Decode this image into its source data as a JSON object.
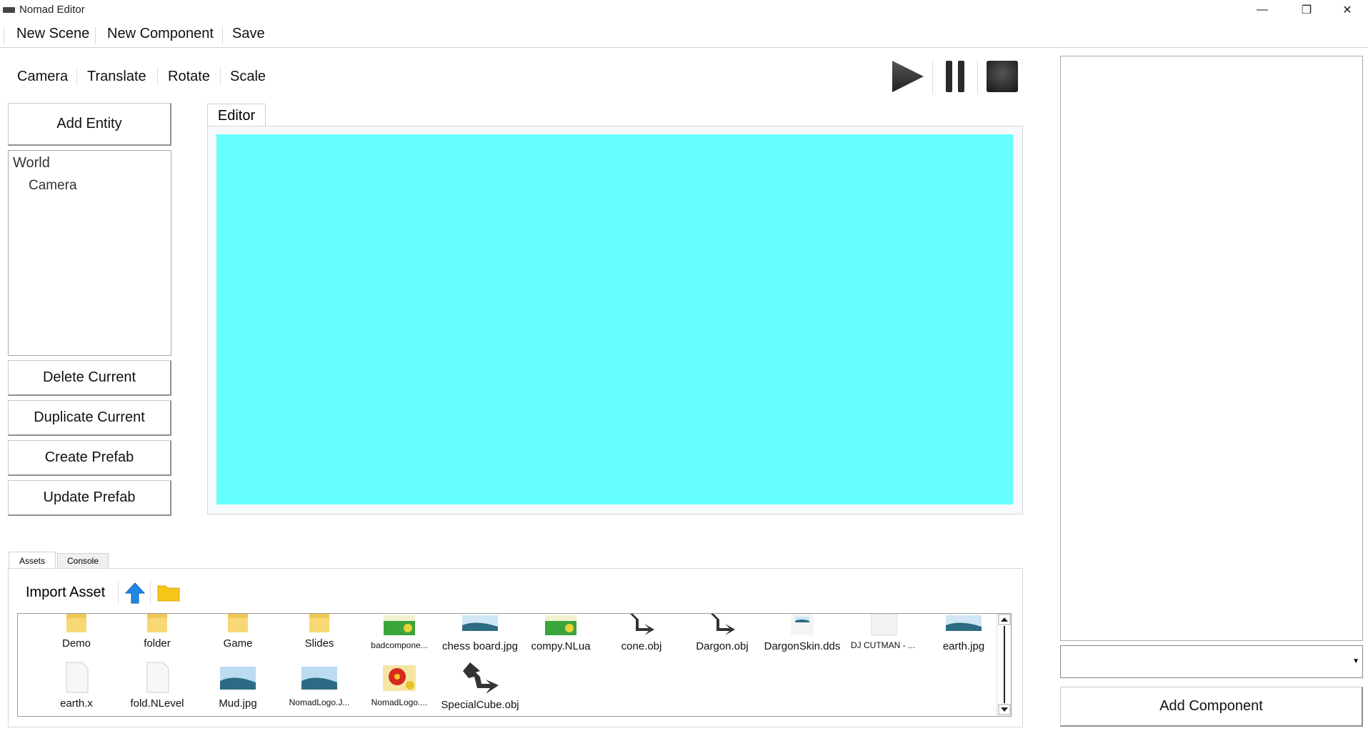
{
  "window": {
    "title": "Nomad Editor"
  },
  "menu": {
    "new_scene": "New Scene",
    "new_component": "New Component",
    "save": "Save"
  },
  "toolbar": {
    "camera": "Camera",
    "translate": "Translate",
    "rotate": "Rotate",
    "scale": "Scale"
  },
  "left_panel": {
    "add_entity": "Add Entity",
    "hierarchy": {
      "root": "World",
      "children": [
        "Camera"
      ]
    },
    "delete_current": "Delete Current",
    "duplicate_current": "Duplicate Current",
    "create_prefab": "Create Prefab",
    "update_prefab": "Update Prefab"
  },
  "editor": {
    "tab_label": "Editor",
    "viewport_color": "#66ffff"
  },
  "bottom": {
    "tabs": [
      "Assets",
      "Console"
    ],
    "import_asset": "Import Asset",
    "assets": [
      {
        "name": "Demo",
        "icon": "folder-icon"
      },
      {
        "name": "folder",
        "icon": "folder-icon"
      },
      {
        "name": "Game",
        "icon": "folder-icon"
      },
      {
        "name": "Slides",
        "icon": "folder-icon"
      },
      {
        "name": "badcompone...",
        "icon": "lua-script-icon"
      },
      {
        "name": "chess board.jpg",
        "icon": "image-icon"
      },
      {
        "name": "compy.NLua",
        "icon": "lua-script-icon"
      },
      {
        "name": "cone.obj",
        "icon": "mesh-icon"
      },
      {
        "name": "Dargon.obj",
        "icon": "mesh-icon"
      },
      {
        "name": "DargonSkin.dds",
        "icon": "image-icon"
      },
      {
        "name": "DJ CUTMAN - ...",
        "icon": "file-icon"
      },
      {
        "name": "earth.jpg",
        "icon": "image-icon"
      },
      {
        "name": "earth.x",
        "icon": "file-icon"
      },
      {
        "name": "fold.NLevel",
        "icon": "file-icon"
      },
      {
        "name": "Mud.jpg",
        "icon": "image-icon"
      },
      {
        "name": "NomadLogo.J...",
        "icon": "image-icon"
      },
      {
        "name": "NomadLogo....",
        "icon": "flower-image-icon"
      },
      {
        "name": "SpecialCube.obj",
        "icon": "mesh-icon"
      }
    ]
  },
  "right_panel": {
    "add_component": "Add Component",
    "component_select_value": ""
  },
  "colors": {
    "viewport": "#66ffff",
    "folder": "#f8d775",
    "accent": "#1e88e5"
  }
}
